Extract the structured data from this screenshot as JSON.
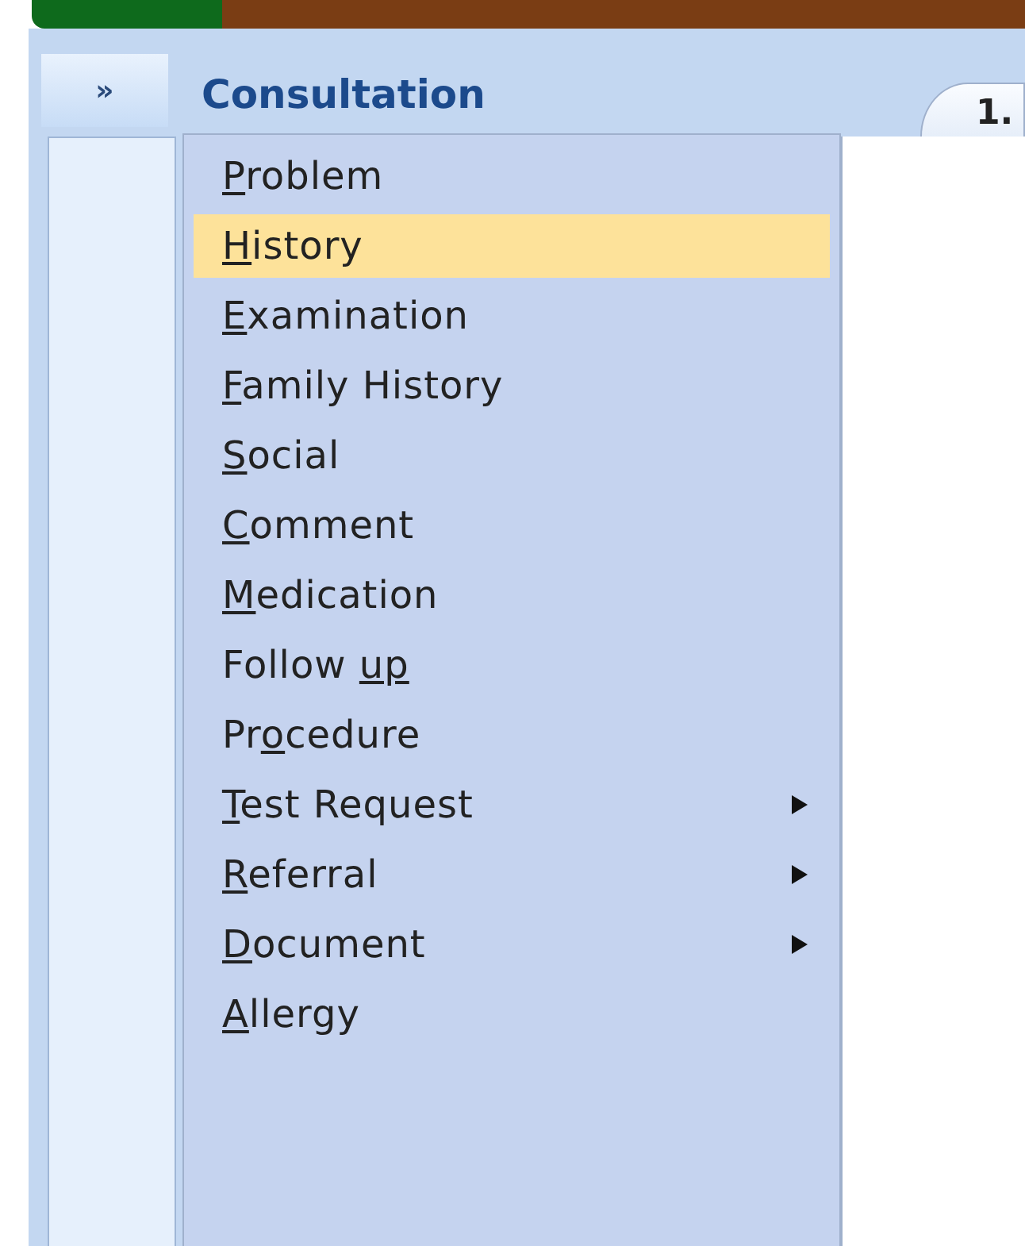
{
  "sidebar_toggle": {
    "label": "»"
  },
  "panel": {
    "title": "Consultation"
  },
  "tab": {
    "label": "1."
  },
  "menu_items": [
    {
      "key": "P",
      "after": "roblem",
      "selected": false,
      "submenu": false
    },
    {
      "key": "H",
      "after": "istory",
      "selected": true,
      "submenu": false
    },
    {
      "key": "E",
      "after": "xamination",
      "selected": false,
      "submenu": false
    },
    {
      "key": "F",
      "after": "amily History",
      "selected": false,
      "submenu": false
    },
    {
      "key": "S",
      "after": "ocial",
      "selected": false,
      "submenu": false
    },
    {
      "key": "C",
      "after": "omment",
      "selected": false,
      "submenu": false
    },
    {
      "key": "M",
      "after": "edication",
      "selected": false,
      "submenu": false
    },
    {
      "before": "Follow ",
      "key": "up",
      "selected": false,
      "submenu": false
    },
    {
      "before": "Pr",
      "key": "o",
      "after": "cedure",
      "selected": false,
      "submenu": false
    },
    {
      "key": "T",
      "after": "est Request",
      "selected": false,
      "submenu": true
    },
    {
      "key": "R",
      "after": "eferral",
      "selected": false,
      "submenu": true
    },
    {
      "key": "D",
      "after": "ocument",
      "selected": false,
      "submenu": true
    },
    {
      "key": "A",
      "after": "llergy",
      "selected": false,
      "submenu": false
    }
  ]
}
